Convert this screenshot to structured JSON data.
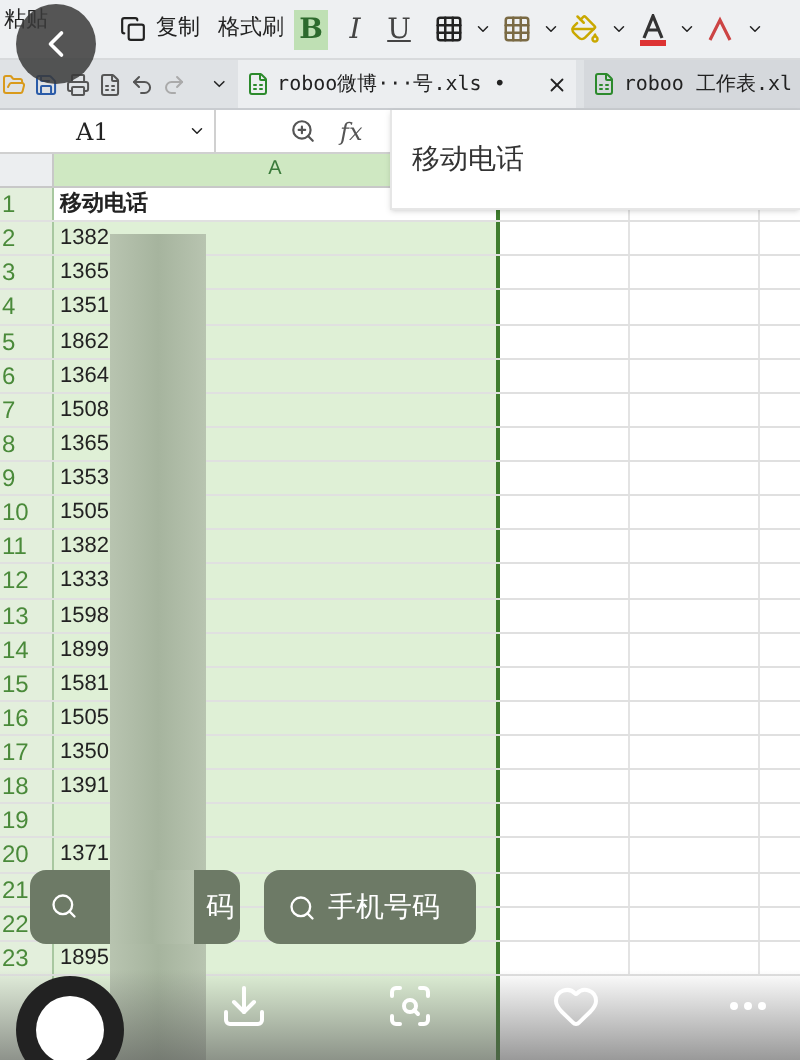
{
  "toolbar": {
    "paste": "粘贴",
    "copy": "复制",
    "format_painter": "格式刷",
    "format_buttons": [
      {
        "label": "B",
        "selected": true
      },
      {
        "label": "I",
        "selected": false
      },
      {
        "label": "U",
        "selected": false
      }
    ]
  },
  "tabs": [
    {
      "label": "roboo微博···号.xls •",
      "selected": true
    },
    {
      "label": "roboo 工作表.xl",
      "selected": false
    }
  ],
  "formula_bar": {
    "cell_ref": "A1",
    "fx_label": "fx",
    "popup_value": "移动电话"
  },
  "sheet": {
    "column_header": "A",
    "rows": [
      {
        "number": "1",
        "value": "移动电话",
        "kind": "header"
      },
      {
        "number": "2",
        "value": "1382",
        "kind": "data"
      },
      {
        "number": "3",
        "value": "1365",
        "kind": "data"
      },
      {
        "number": "4",
        "value": "1351",
        "kind": "data"
      },
      {
        "number": "5",
        "value": "1862",
        "kind": "data"
      },
      {
        "number": "6",
        "value": "1364",
        "kind": "data"
      },
      {
        "number": "7",
        "value": "1508",
        "kind": "data"
      },
      {
        "number": "8",
        "value": "1365",
        "kind": "data"
      },
      {
        "number": "9",
        "value": "1353",
        "kind": "data"
      },
      {
        "number": "10",
        "value": "1505",
        "kind": "data"
      },
      {
        "number": "11",
        "value": "1382",
        "kind": "data"
      },
      {
        "number": "12",
        "value": "1333",
        "kind": "data"
      },
      {
        "number": "13",
        "value": "1598",
        "kind": "data"
      },
      {
        "number": "14",
        "value": "1899",
        "kind": "data"
      },
      {
        "number": "15",
        "value": "1581",
        "kind": "data"
      },
      {
        "number": "16",
        "value": "1505",
        "kind": "data"
      },
      {
        "number": "17",
        "value": "1350",
        "kind": "data"
      },
      {
        "number": "18",
        "value": "1391",
        "kind": "data"
      },
      {
        "number": "19",
        "kind": "data"
      },
      {
        "number": "20",
        "value": "1371",
        "kind": "data"
      },
      {
        "number": "21",
        "kind": "data"
      },
      {
        "number": "22",
        "kind": "data"
      },
      {
        "number": "23",
        "value": "1895",
        "kind": "data"
      }
    ]
  },
  "search_chips": [
    {
      "label": "码"
    },
    {
      "label": "手机号码"
    }
  ]
}
